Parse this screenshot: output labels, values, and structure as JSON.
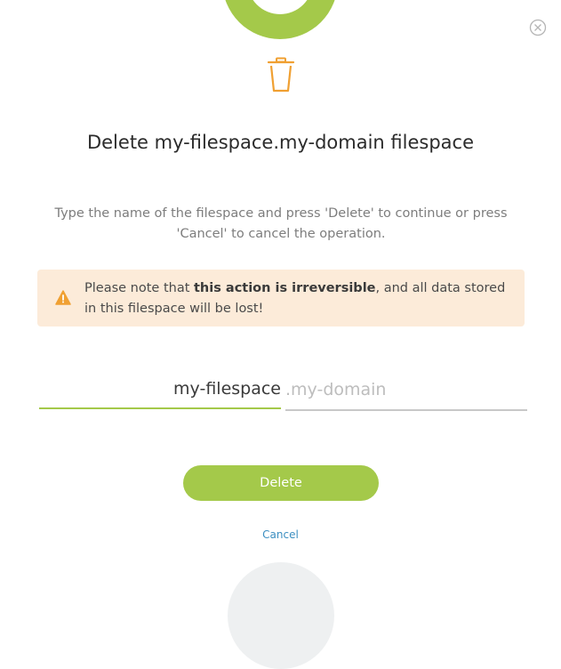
{
  "dialog": {
    "close_icon": "close-icon",
    "trash_icon": "trash-icon",
    "title": "Delete my-filespace.my-domain filespace",
    "instructions": "Type the name of the filespace and press 'Delete' to continue or press 'Cancel' to cancel the operation.",
    "warning": {
      "icon": "warning-icon",
      "text_before": "Please note that ",
      "text_bold": "this action is irreversible",
      "text_after": ", and all data stored in this filespace will be lost!"
    },
    "input": {
      "value": "my-filespace",
      "suffix": ".my-domain"
    },
    "delete_label": "Delete",
    "cancel_label": "Cancel"
  },
  "colors": {
    "accent": "#a4c94a",
    "trash_icon": "#f0a032",
    "warning_bg": "#fcebd9",
    "warning_icon": "#f0a032",
    "link": "#3c8fc1"
  }
}
